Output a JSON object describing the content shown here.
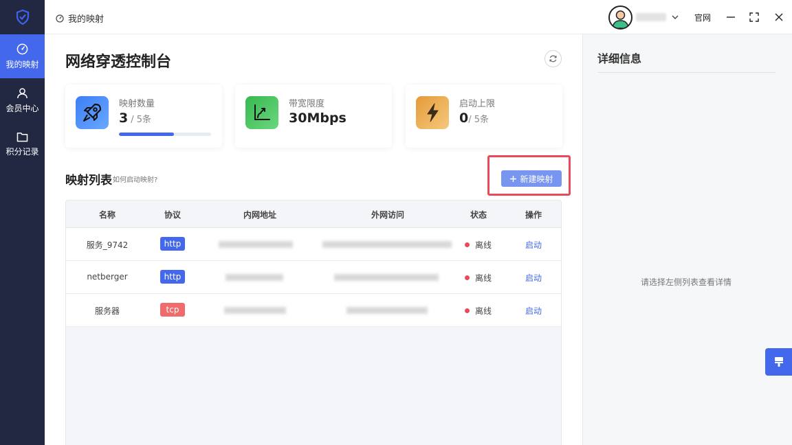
{
  "sidebar": {
    "items": [
      {
        "label": "我的映射",
        "icon": "dashboard-icon",
        "active": true
      },
      {
        "label": "会员中心",
        "icon": "user-icon",
        "active": false
      },
      {
        "label": "积分记录",
        "icon": "folder-icon",
        "active": false
      }
    ]
  },
  "topbar": {
    "breadcrumb": "我的映射",
    "site_link": "官网"
  },
  "main": {
    "title": "网络穿透控制台",
    "cards": [
      {
        "label": "映射数量",
        "value": "3",
        "sub": "/ 5条",
        "progress": 0.6,
        "color": "#4a8cf7"
      },
      {
        "label": "带宽限度",
        "value": "30Mbps",
        "sub": "",
        "color": "#3fbf5a"
      },
      {
        "label": "启动上限",
        "value": "0",
        "sub": "/ 5条",
        "color": "#ecae4f"
      }
    ],
    "list_title": "映射列表",
    "list_hint": "如何启动映射?",
    "new_button": "新建映射",
    "table": {
      "headers": [
        "名称",
        "协议",
        "内网地址",
        "外网访问",
        "状态",
        "操作"
      ],
      "rows": [
        {
          "name": "服务_9742",
          "protocol": "http",
          "status": "离线",
          "action": "启动"
        },
        {
          "name": "netberger",
          "protocol": "http",
          "status": "离线",
          "action": "启动"
        },
        {
          "name": "服务器",
          "protocol": "tcp",
          "status": "离线",
          "action": "启动"
        }
      ]
    }
  },
  "detail": {
    "title": "详细信息",
    "empty_text": "请选择左侧列表查看详情"
  },
  "colors": {
    "accent": "#4468ec",
    "sidebar_bg": "#222841",
    "http_badge": "#4468ec",
    "tcp_badge": "#f06b6b",
    "offline_dot": "#ea4b5a",
    "highlight": "#ea4b5a"
  }
}
